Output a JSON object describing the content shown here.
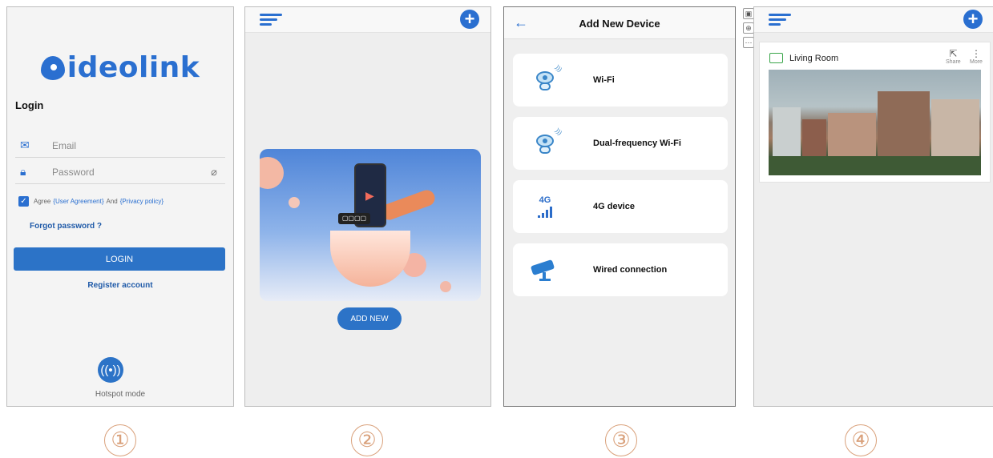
{
  "screen1": {
    "logo": "ideolink",
    "login_title": "Login",
    "email_placeholder": "Email",
    "password_placeholder": "Password",
    "agree_text": "Agree",
    "user_agreement": "{User Agreement}",
    "and_text": "And",
    "privacy_policy": "{Privacy policy}",
    "forgot_password": "Forgot password ?",
    "login_button": "LOGIN",
    "register": "Register account",
    "hotspot_label": "Hotspot mode",
    "icons": [
      "envelope-icon",
      "lock-icon",
      "eye-slash-icon",
      "checkbox-icon",
      "hotspot-icon"
    ]
  },
  "screen2": {
    "add_new_button": "ADD NEW",
    "banner_tag": "▢▢▢▢",
    "icons": [
      "menu-icon",
      "plus-icon"
    ]
  },
  "screen3": {
    "title": "Add New Device",
    "options": [
      {
        "label": "Wi-Fi",
        "icon": "wifi-camera-icon"
      },
      {
        "label": "Dual-frequency Wi-Fi",
        "icon": "dual-wifi-camera-icon"
      },
      {
        "label": "4G device",
        "icon": "4g-signal-icon",
        "badge": "4G"
      },
      {
        "label": "Wired connection",
        "icon": "wired-camera-icon"
      }
    ]
  },
  "screen4": {
    "device_name": "Living Room",
    "share_label": "Share",
    "more_label": "More",
    "icons": [
      "menu-icon",
      "plus-icon",
      "tv-icon",
      "share-icon",
      "more-icon"
    ]
  },
  "step_labels": [
    "①",
    "②",
    "③",
    "④"
  ],
  "colors": {
    "accent": "#2a6fd0",
    "button": "#2c73c7",
    "device_icon": "#3aa64a"
  }
}
